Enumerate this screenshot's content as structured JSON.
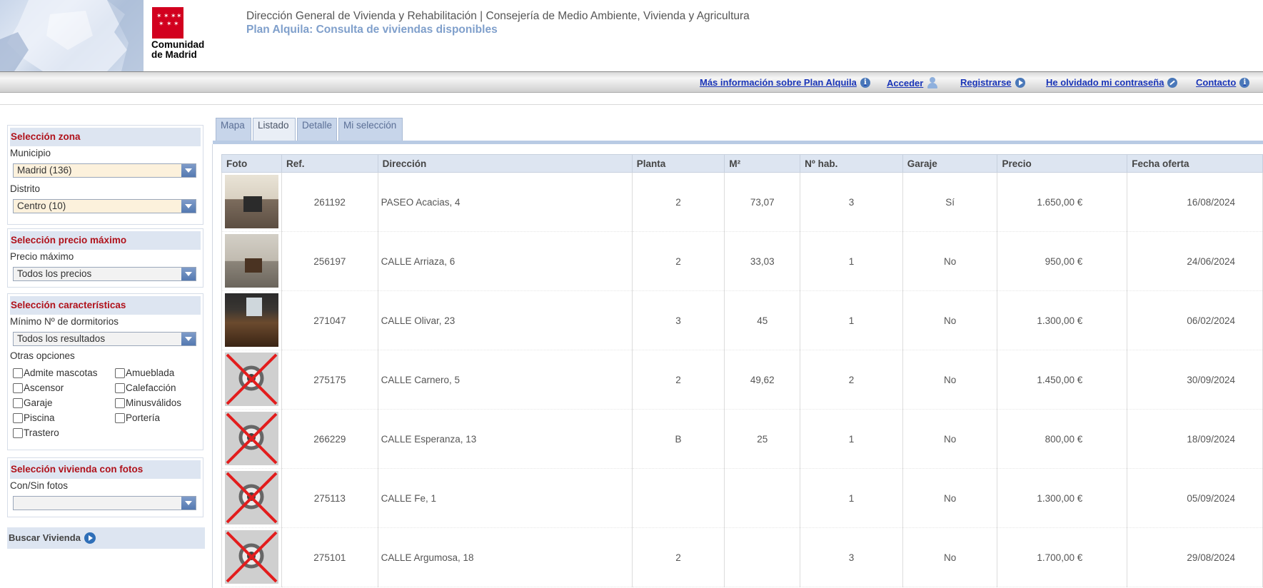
{
  "header": {
    "org": "Dirección General de Vivienda y Rehabilitación | Consejería de Medio Ambiente, Vivienda y Agricultura",
    "app_title": "Plan Alquila: Consulta de viviendas disponibles",
    "logo_text_1": "Comunidad",
    "logo_text_2": "de Madrid"
  },
  "toolbar": {
    "info_link": "Más información sobre Plan Alquila",
    "login_link": "Acceder",
    "register_link": "Registrarse",
    "forgot_link": "He olvidado mi contraseña",
    "contact_link": "Contacto"
  },
  "sidebar": {
    "zona": {
      "title": "Selección zona",
      "municipio_label": "Municipio",
      "municipio_value": "Madrid (136)",
      "distrito_label": "Distrito",
      "distrito_value": "Centro (10)"
    },
    "precio": {
      "title": "Selección precio máximo",
      "label": "Precio máximo",
      "value": "Todos los precios"
    },
    "caracteristicas": {
      "title": "Selección características",
      "dormitorios_label": "Mínimo Nº de dormitorios",
      "dormitorios_value": "Todos los resultados",
      "otras_label": "Otras opciones",
      "options": [
        "Admite mascotas",
        "Amueblada",
        "Ascensor",
        "Calefacción",
        "Garaje",
        "Minusválidos",
        "Piscina",
        "Portería",
        "Trastero"
      ]
    },
    "fotos": {
      "title": "Selección vivienda con fotos",
      "label": "Con/Sin fotos",
      "value": ""
    },
    "search_button": "Buscar Vivienda"
  },
  "tabs": [
    "Mapa",
    "Listado",
    "Detalle",
    "Mi selección"
  ],
  "active_tab": "Listado",
  "table": {
    "columns": [
      "Foto",
      "Ref.",
      "Dirección",
      "Planta",
      "M²",
      "Nº hab.",
      "Garaje",
      "Precio",
      "Fecha oferta"
    ],
    "rows": [
      {
        "foto": "photo",
        "ref": "261192",
        "direccion": "PASEO Acacias, 4",
        "planta": "2",
        "m2": "73,07",
        "hab": "3",
        "garaje": "Sí",
        "precio": "1.650,00 €",
        "fecha": "16/08/2024"
      },
      {
        "foto": "photo",
        "ref": "256197",
        "direccion": "CALLE Arriaza, 6",
        "planta": "2",
        "m2": "33,03",
        "hab": "1",
        "garaje": "No",
        "precio": "950,00 €",
        "fecha": "24/06/2024"
      },
      {
        "foto": "photo",
        "ref": "271047",
        "direccion": "CALLE Olivar, 23",
        "planta": "3",
        "m2": "45",
        "hab": "1",
        "garaje": "No",
        "precio": "1.300,00 €",
        "fecha": "06/02/2024"
      },
      {
        "foto": "no-photo",
        "ref": "275175",
        "direccion": "CALLE Carnero, 5",
        "planta": "2",
        "m2": "49,62",
        "hab": "2",
        "garaje": "No",
        "precio": "1.450,00 €",
        "fecha": "30/09/2024"
      },
      {
        "foto": "no-photo",
        "ref": "266229",
        "direccion": "CALLE Esperanza, 13",
        "planta": "B",
        "m2": "25",
        "hab": "1",
        "garaje": "No",
        "precio": "800,00 €",
        "fecha": "18/09/2024"
      },
      {
        "foto": "no-photo",
        "ref": "275113",
        "direccion": "CALLE Fe, 1",
        "planta": "",
        "m2": "",
        "hab": "1",
        "garaje": "No",
        "precio": "1.300,00 €",
        "fecha": "05/09/2024"
      },
      {
        "foto": "no-photo",
        "ref": "275101",
        "direccion": "CALLE Argumosa, 18",
        "planta": "2",
        "m2": "",
        "hab": "3",
        "garaje": "No",
        "precio": "1.700,00 €",
        "fecha": "29/08/2024"
      }
    ]
  },
  "colors": {
    "panel_title": "#b0121b",
    "app_title": "#7f9fcb",
    "link": "#1a35b8",
    "panel_bg": "#dde5f1"
  }
}
